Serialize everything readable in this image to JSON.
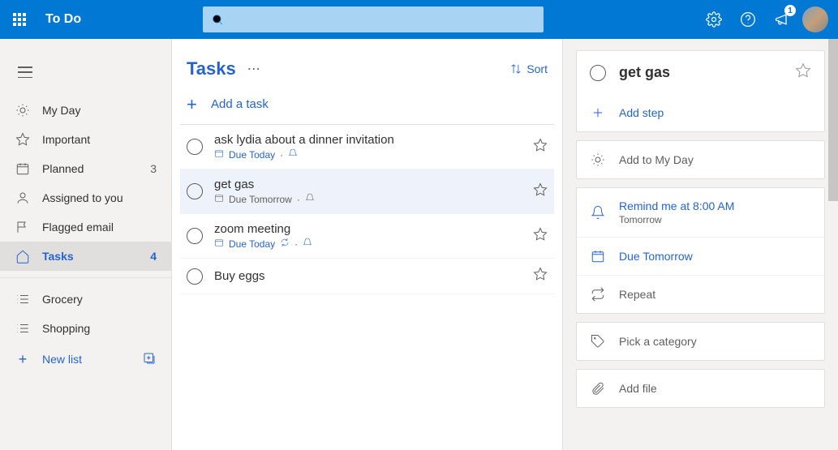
{
  "header": {
    "app_title": "To Do",
    "notification_count": "1"
  },
  "sidebar": {
    "items": [
      {
        "icon": "sun",
        "label": "My Day",
        "count": ""
      },
      {
        "icon": "star",
        "label": "Important",
        "count": ""
      },
      {
        "icon": "calendar",
        "label": "Planned",
        "count": "3"
      },
      {
        "icon": "person",
        "label": "Assigned to you",
        "count": ""
      },
      {
        "icon": "flag",
        "label": "Flagged email",
        "count": ""
      },
      {
        "icon": "home",
        "label": "Tasks",
        "count": "4",
        "active": true
      }
    ],
    "lists": [
      {
        "icon": "list",
        "label": "Grocery"
      },
      {
        "icon": "list",
        "label": "Shopping"
      }
    ],
    "new_list_label": "New list"
  },
  "main": {
    "title": "Tasks",
    "sort_label": "Sort",
    "add_task_placeholder": "Add a task",
    "tasks": [
      {
        "title": "ask lydia about a dinner invitation",
        "due": "Due Today",
        "has_reminder": true,
        "has_recur": false,
        "selected": false,
        "overdue_style": true
      },
      {
        "title": "get gas",
        "due": "Due Tomorrow",
        "has_reminder": true,
        "has_recur": false,
        "selected": true,
        "overdue_style": false
      },
      {
        "title": "zoom meeting",
        "due": "Due Today",
        "has_reminder": true,
        "has_recur": true,
        "selected": false,
        "overdue_style": true
      },
      {
        "title": "Buy eggs",
        "due": "",
        "has_reminder": false,
        "has_recur": false,
        "selected": false,
        "overdue_style": false
      }
    ]
  },
  "details": {
    "task_title": "get gas",
    "add_step_label": "Add step",
    "add_my_day_label": "Add to My Day",
    "reminder_label": "Remind me at 8:00 AM",
    "reminder_sub": "Tomorrow",
    "due_label": "Due Tomorrow",
    "repeat_label": "Repeat",
    "category_label": "Pick a category",
    "file_label": "Add file"
  }
}
